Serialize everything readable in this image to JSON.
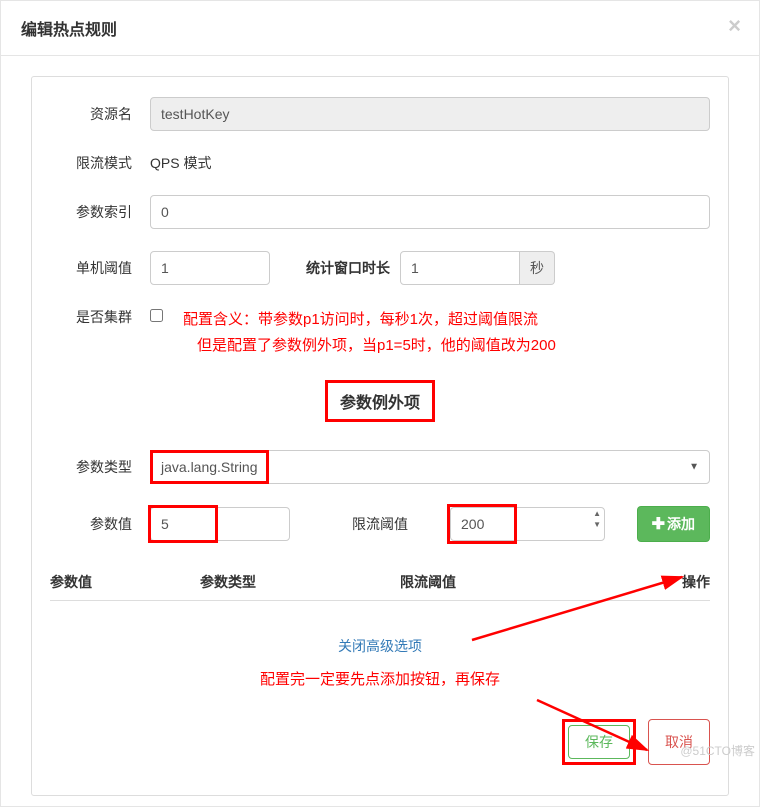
{
  "modal": {
    "title": "编辑热点规则",
    "close": "×"
  },
  "form": {
    "resource_label": "资源名",
    "resource_value": "testHotKey",
    "mode_label": "限流模式",
    "mode_value": "QPS 模式",
    "param_index_label": "参数索引",
    "param_index_value": "0",
    "threshold_label": "单机阈值",
    "threshold_value": "1",
    "window_label": "统计窗口时长",
    "window_value": "1",
    "window_unit": "秒",
    "cluster_label": "是否集群",
    "note_line1": "配置含义：带参数p1访问时，每秒1次，超过阈值限流",
    "note_line2": "但是配置了参数例外项，当p1=5时，他的阈值改为200"
  },
  "exception": {
    "header": "参数例外项",
    "type_label": "参数类型",
    "type_value": "java.lang.String",
    "value_label": "参数值",
    "value_input": "5",
    "threshold_label": "限流阈值",
    "threshold_input": "200",
    "add_button": "添加"
  },
  "table": {
    "col1": "参数值",
    "col2": "参数类型",
    "col3": "限流阈值",
    "col4": "操作"
  },
  "advanced": {
    "close_link": "关闭高级选项",
    "note": "配置完一定要先点添加按钮，再保存"
  },
  "footer": {
    "save": "保存",
    "cancel": "取消"
  },
  "watermark": "@51CTO博客"
}
